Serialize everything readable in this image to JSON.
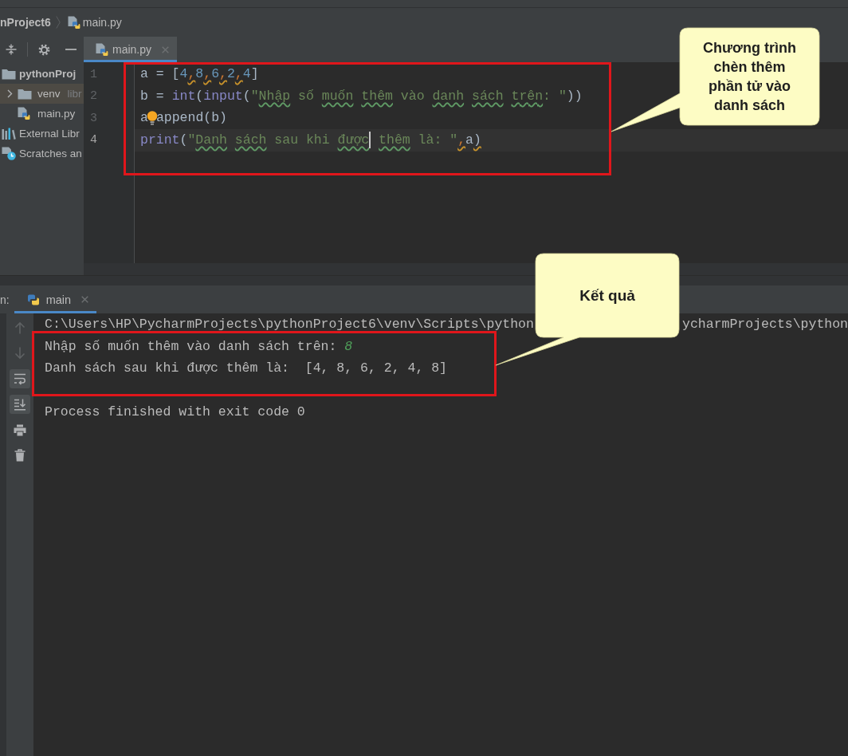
{
  "breadcrumb": {
    "items": [
      {
        "kind": "project",
        "text": "nProject6"
      },
      {
        "kind": "file",
        "text": "main.py"
      }
    ]
  },
  "project": {
    "tree": [
      {
        "kind": "root",
        "label": "pythonProj",
        "selected": false,
        "children": [
          {
            "kind": "folder",
            "label": "venv",
            "note": "libr",
            "expanded": false,
            "selected": true
          },
          {
            "kind": "file",
            "label": "main.py",
            "selected": false
          }
        ]
      },
      {
        "kind": "libraries",
        "label": "External Libr",
        "selected": false
      },
      {
        "kind": "scratches",
        "label": "Scratches an",
        "selected": false
      }
    ]
  },
  "editor": {
    "tabs": [
      {
        "label": "main.py",
        "selected": true
      }
    ],
    "lines": [
      {
        "number": "1",
        "current": false,
        "tokens": [
          {
            "kind": "plain",
            "text": "a = [",
            "flagged": false
          },
          {
            "kind": "number",
            "text": "4",
            "flagged": false
          },
          {
            "kind": "comma",
            "text": ",",
            "flagged": true
          },
          {
            "kind": "number",
            "text": "8",
            "flagged": false
          },
          {
            "kind": "comma",
            "text": ",",
            "flagged": true
          },
          {
            "kind": "number",
            "text": "6",
            "flagged": false
          },
          {
            "kind": "comma",
            "text": ",",
            "flagged": true
          },
          {
            "kind": "number",
            "text": "2",
            "flagged": false
          },
          {
            "kind": "comma",
            "text": ",",
            "flagged": true
          },
          {
            "kind": "number",
            "text": "4",
            "flagged": false
          },
          {
            "kind": "plain",
            "text": "]",
            "flagged": false
          }
        ]
      },
      {
        "number": "2",
        "current": false,
        "tokens": [
          {
            "kind": "plain",
            "text": "b = ",
            "flagged": false
          },
          {
            "kind": "builtin",
            "text": "int",
            "flagged": false
          },
          {
            "kind": "plain",
            "text": "(",
            "flagged": false
          },
          {
            "kind": "builtin",
            "text": "input",
            "flagged": false
          },
          {
            "kind": "plain",
            "text": "(",
            "flagged": false
          },
          {
            "kind": "string",
            "text": "\"",
            "flagged": false
          },
          {
            "kind": "string",
            "text": "Nhập",
            "flagged": true
          },
          {
            "kind": "string",
            "text": " số ",
            "flagged": false
          },
          {
            "kind": "string",
            "text": "muốn ",
            "flagged": true
          },
          {
            "kind": "string",
            "text": "thêm",
            "flagged": true
          },
          {
            "kind": "string",
            "text": " vào ",
            "flagged": false
          },
          {
            "kind": "string",
            "text": "danh ",
            "flagged": true
          },
          {
            "kind": "string",
            "text": "sách ",
            "flagged": true
          },
          {
            "kind": "string",
            "text": "trên",
            "flagged": true
          },
          {
            "kind": "string",
            "text": ": \"",
            "flagged": false
          },
          {
            "kind": "plain",
            "text": "))",
            "flagged": false
          }
        ]
      },
      {
        "number": "3",
        "current": false,
        "tokens": [
          {
            "kind": "plain",
            "text": "a",
            "flagged": false
          },
          {
            "kind": "bulb"
          },
          {
            "kind": "plain",
            "text": "append(b)",
            "flagged": false
          }
        ]
      },
      {
        "number": "4",
        "current": true,
        "tokens": [
          {
            "kind": "builtin",
            "text": "print",
            "flagged": false
          },
          {
            "kind": "plain",
            "text": "(",
            "flagged": false
          },
          {
            "kind": "string",
            "text": "\"",
            "flagged": false
          },
          {
            "kind": "string",
            "text": "Danh ",
            "flagged": true
          },
          {
            "kind": "string",
            "text": "sách",
            "flagged": true
          },
          {
            "kind": "string",
            "text": " sau khi ",
            "flagged": false
          },
          {
            "kind": "string",
            "text": "được",
            "flagged": true
          },
          {
            "kind": "caret"
          },
          {
            "kind": "string",
            "text": " thêm",
            "flagged": true
          },
          {
            "kind": "string",
            "text": " là: \"",
            "flagged": false
          },
          {
            "kind": "comma",
            "text": ",",
            "flagged": true
          },
          {
            "kind": "plain",
            "text": "a",
            "flagged": false
          },
          {
            "kind": "plain",
            "text": ")",
            "flagged": true
          }
        ]
      }
    ]
  },
  "run": {
    "title": "n:",
    "tabs": [
      {
        "label": "main",
        "selected": true
      }
    ],
    "toolbar": [
      {
        "kind": "up",
        "disabled": true,
        "toggled": false
      },
      {
        "kind": "down",
        "disabled": true,
        "toggled": false
      },
      {
        "kind": "wrap",
        "disabled": false,
        "toggled": true
      },
      {
        "kind": "scroll-end",
        "disabled": false,
        "toggled": true
      },
      {
        "kind": "print",
        "disabled": false,
        "toggled": false
      },
      {
        "kind": "trash",
        "disabled": false,
        "toggled": false
      }
    ],
    "output": [
      {
        "kind": "command",
        "segments": [
          {
            "kind": "text",
            "text": "C:\\Users\\HP\\PycharmProjects\\pythonProject6\\venv\\Scripts\\python"
          },
          {
            "kind": "text",
            "text": "ycharmProjects\\python"
          }
        ]
      },
      {
        "kind": "stdout",
        "segments": [
          {
            "kind": "text",
            "text": "Nhập số muốn thêm vào danh sách trên:"
          },
          {
            "kind": "input",
            "text": "8"
          }
        ]
      },
      {
        "kind": "stdout",
        "segments": [
          {
            "kind": "text",
            "text": "Danh sách sau khi được thêm là:  [4, 8, 6, 2, 4, 8]"
          }
        ]
      },
      {
        "kind": "exit",
        "segments": [
          {
            "kind": "text",
            "text": "Process finished with exit code 0"
          }
        ]
      }
    ]
  },
  "callouts": [
    {
      "text": "Chương trình chèn thêm phần tử vào danh sách"
    },
    {
      "text": "Kết quả"
    }
  ]
}
